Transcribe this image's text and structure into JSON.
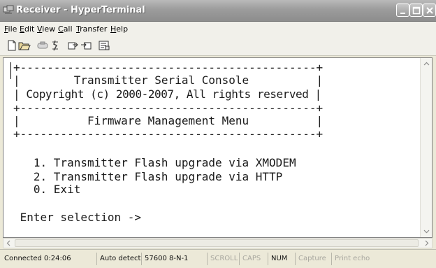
{
  "window": {
    "title": "Receiver - HyperTerminal"
  },
  "menu": {
    "items": [
      {
        "first": "F",
        "rest": "ile"
      },
      {
        "first": "E",
        "rest": "dit"
      },
      {
        "first": "V",
        "rest": "iew"
      },
      {
        "first": "C",
        "rest": "all"
      },
      {
        "first": "T",
        "rest": "ransfer"
      },
      {
        "first": "H",
        "rest": "elp"
      }
    ]
  },
  "toolbar": {
    "icons": [
      "new-connection-icon",
      "open-icon",
      "connect-icon",
      "disconnect-icon",
      "send-icon",
      "receive-icon",
      "properties-icon"
    ]
  },
  "terminal": {
    "lines": [
      "+--------------------------------------------+",
      "|        Transmitter Serial Console          |",
      "| Copyright (c) 2000-2007, All rights reserved |",
      "+--------------------------------------------+",
      "|          Firmware Management Menu          |",
      "+--------------------------------------------+",
      "",
      "",
      "   1. Transmitter Flash upgrade via XMODEM",
      "   2. Transmitter Flash upgrade via HTTP",
      "   0. Exit",
      "",
      " Enter selection ->"
    ]
  },
  "status": {
    "connected": "Connected 0:24:06",
    "detect": "Auto detect",
    "settings": "57600 8-N-1",
    "scroll": "SCROLL",
    "caps": "CAPS",
    "num": "NUM",
    "capture": "Capture",
    "print_echo": "Print echo"
  }
}
